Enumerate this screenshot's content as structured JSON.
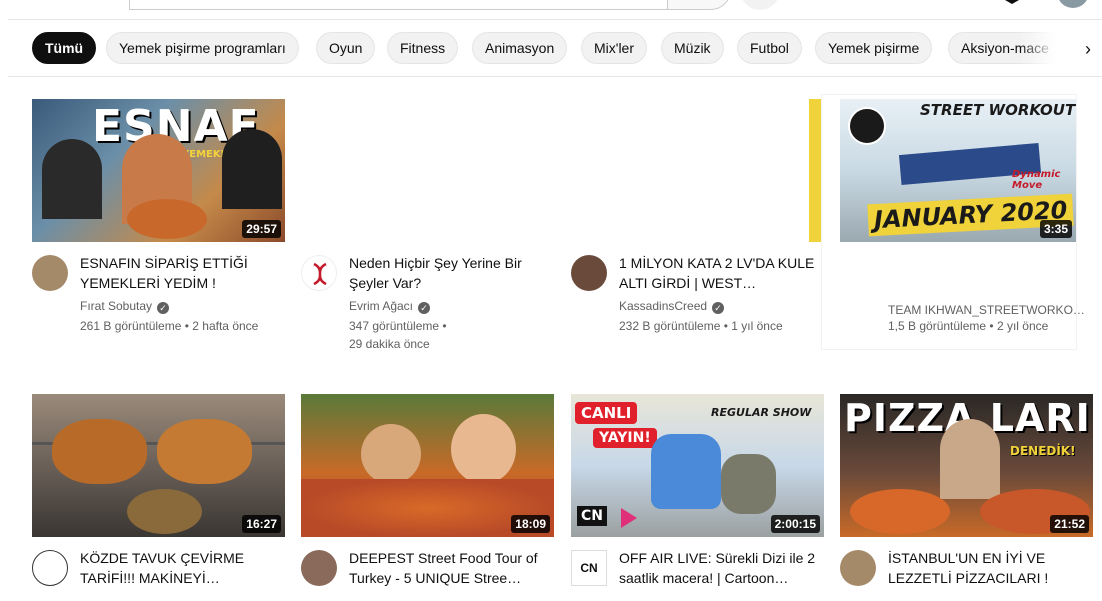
{
  "chips": [
    {
      "label": "Tümü",
      "active": true
    },
    {
      "label": "Yemek pişirme programları"
    },
    {
      "label": "Oyun"
    },
    {
      "label": "Fitness"
    },
    {
      "label": "Animasyon"
    },
    {
      "label": "Mix'ler"
    },
    {
      "label": "Müzik"
    },
    {
      "label": "Futbol"
    },
    {
      "label": "Yemek pişirme"
    },
    {
      "label": "Aksiyon-mace"
    }
  ],
  "next_chip_icon": "chevron-right-icon",
  "videos": [
    {
      "title": "ESNAFIN SİPARİŞ ETTİĞİ YEMEKLERİ YEDİM !",
      "channel": "Fırat Sobutay",
      "verified": true,
      "views": "261 B görüntüleme",
      "age": "2 hafta önce",
      "duration": "29:57",
      "thumb_text": "ESNAF",
      "thumb_subtext": "YEMEKLERİ"
    },
    {
      "title": "Neden Hiçbir Şey Yerine Bir Şeyler Var?",
      "channel": "Evrim Ağacı",
      "verified": true,
      "views": "347 görüntüleme",
      "age": "29 dakika önce",
      "duration": ""
    },
    {
      "title": "1 MİLYON KATA 2 LV'DA KULE ALTI GİRDİ | WEST…",
      "channel": "KassadinsCreed",
      "verified": true,
      "views": "232 B görüntüleme",
      "age": "1 yıl önce",
      "duration": ""
    },
    {
      "title": "",
      "channel": "TEAM IKHWAN_STREETWORKO…",
      "verified": false,
      "views": "1,5 B görüntüleme",
      "age": "2 yıl önce",
      "duration": "3:35",
      "thumb_text": "JANUARY 2020",
      "thumb_top": "STREET WORKOUT",
      "thumb_sub": "Dynamic Move"
    },
    {
      "title": "KÖZDE TAVUK ÇEVİRME TARİFİ!!! MAKİNEYİ…",
      "duration": "16:27"
    },
    {
      "title": "DEEPEST Street Food Tour of Turkey - 5 UNIQUE Stree…",
      "duration": "18:09"
    },
    {
      "title": "OFF AIR LIVE: Sürekli Dizi ile 2 saatlik macera! | Cartoon…",
      "duration": "2:00:15",
      "thumb_badge1": "CANLI",
      "thumb_badge2": "YAYIN!",
      "thumb_show": "REGULAR SHOW",
      "thumb_logo": "CN",
      "avatar_text": "CN"
    },
    {
      "title": "İSTANBUL'UN EN İYİ VE LEZZETLİ PİZZACILARI !",
      "duration": "21:52",
      "thumb_text": "PIZZA LARI",
      "thumb_sub": "DENEDİK!"
    }
  ],
  "colors": {
    "chip_active": "#0f0f0f",
    "chip_bg": "#f2f2f2",
    "meta_text": "#606060",
    "duration_bg": "#000000"
  }
}
